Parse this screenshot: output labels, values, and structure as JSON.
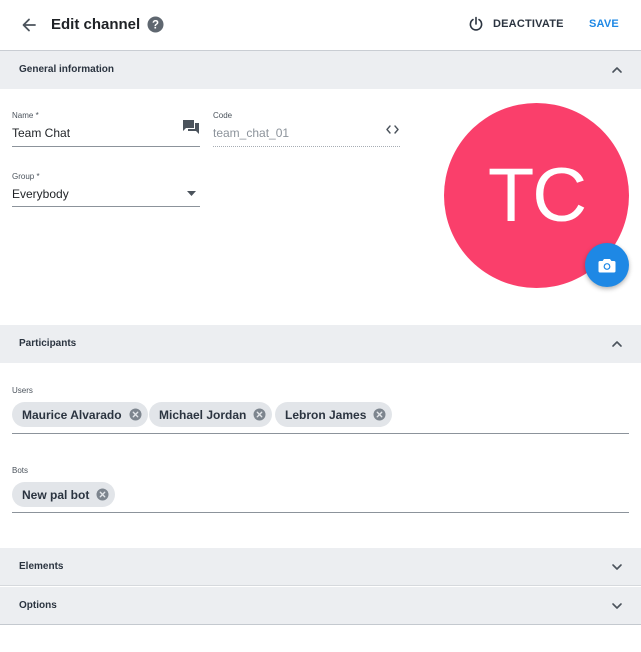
{
  "header": {
    "title": "Edit channel",
    "deactivate_label": "DEACTIVATE",
    "save_label": "SAVE"
  },
  "sections": {
    "general": {
      "label": "General information",
      "expanded": true
    },
    "participants": {
      "label": "Participants",
      "expanded": true
    },
    "elements": {
      "label": "Elements",
      "expanded": false
    },
    "options": {
      "label": "Options",
      "expanded": false
    }
  },
  "general": {
    "name": {
      "label": "Name *",
      "value": "Team Chat"
    },
    "code": {
      "label": "Code",
      "value": "team_chat_01"
    },
    "group": {
      "label": "Group *",
      "value": "Everybody"
    },
    "avatar_initials": "TC"
  },
  "participants": {
    "users_label": "Users",
    "users": [
      "Maurice Alvarado",
      "Michael Jordan",
      "Lebron James"
    ],
    "bots_label": "Bots",
    "bots": [
      "New pal bot"
    ]
  },
  "colors": {
    "accent": "#1e88e5",
    "avatar_bg": "#fa3f6b",
    "section_bg": "#eceef1"
  },
  "icons": {
    "back": "arrow-left-icon",
    "help": "help-circle-icon",
    "deactivate": "power-icon",
    "name_field": "chat-bubbles-icon",
    "code_field": "code-brackets-icon",
    "group_field": "dropdown-caret-icon",
    "camera": "camera-icon",
    "chip_remove": "close-circle-icon"
  }
}
